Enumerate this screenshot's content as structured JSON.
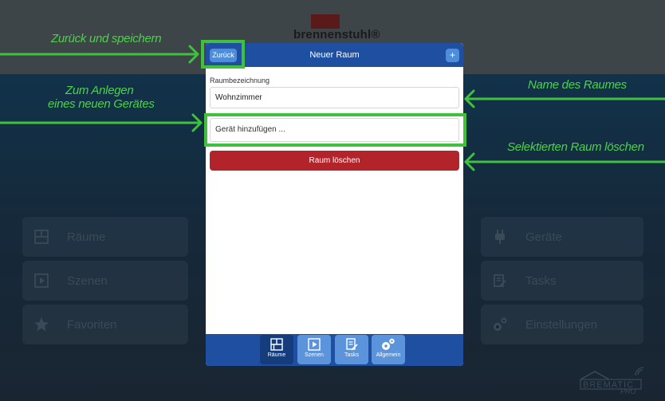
{
  "brand": {
    "name": "brennenstuhl®",
    "product": "BREMATIC PRO"
  },
  "modal": {
    "title": "Neuer Raum",
    "back_label": "Zurück",
    "add_label": "+",
    "field_label": "Raumbezeichnung",
    "room_name_value": "Wohnzimmer",
    "add_device_label": "Gerät hinzufügen ...",
    "delete_label": "Raum löschen"
  },
  "tabbar": {
    "tabs": [
      {
        "label": "Räume",
        "icon": "grid-icon"
      },
      {
        "label": "Szenen",
        "icon": "play-icon"
      },
      {
        "label": "Tasks",
        "icon": "document-pen-icon"
      },
      {
        "label": "Allgemein",
        "icon": "gears-icon"
      }
    ]
  },
  "background_tiles": {
    "left": [
      {
        "label": "Räume",
        "icon": "grid-icon"
      },
      {
        "label": "Szenen",
        "icon": "play-icon"
      },
      {
        "label": "Favoriten",
        "icon": "star-icon"
      }
    ],
    "right": [
      {
        "label": "Geräte",
        "icon": "plug-icon"
      },
      {
        "label": "Tasks",
        "icon": "document-pen-icon"
      },
      {
        "label": "Einstellungen",
        "icon": "gears-icon"
      }
    ]
  },
  "annotations": {
    "back_save": "Zurück und speichern",
    "new_device_line1": "Zum Anlegen",
    "new_device_line2": "eines neuen Gerätes",
    "room_name": "Name des Raumes",
    "delete_room": "Selektierten Raum löschen"
  },
  "colors": {
    "annotation_green": "#3fc13e",
    "header_blue": "#1f4fa0",
    "button_blue": "#4d8dd9",
    "delete_red": "#b3232a"
  }
}
